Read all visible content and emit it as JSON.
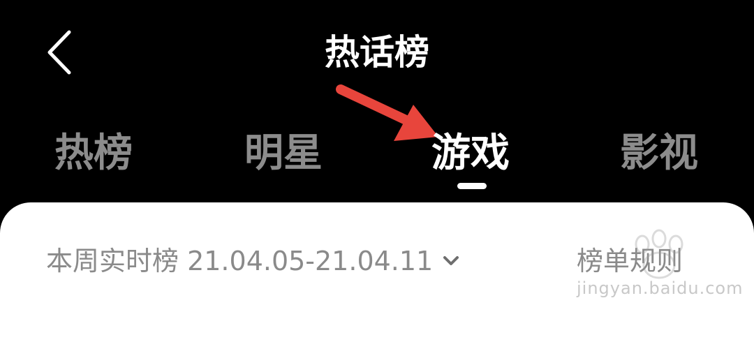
{
  "header": {
    "title": "热话榜",
    "back_icon": "chevron-left-icon"
  },
  "tabs": [
    {
      "label": "热榜",
      "active": false
    },
    {
      "label": "明星",
      "active": false
    },
    {
      "label": "游戏",
      "active": true
    },
    {
      "label": "影视",
      "active": false
    }
  ],
  "card": {
    "period_label": "本周实时榜 21.04.05-21.04.11",
    "dropdown_icon": "chevron-down-icon",
    "rules_label": "榜单规则",
    "watermark_text": "jingyan.baidu.com"
  },
  "colors": {
    "background": "#000000",
    "active_tab": "#ffffff",
    "inactive_tab": "#8c8c8c",
    "annotation_arrow": "#e8453c",
    "card": "#ffffff",
    "card_text": "#8a8a8a"
  }
}
